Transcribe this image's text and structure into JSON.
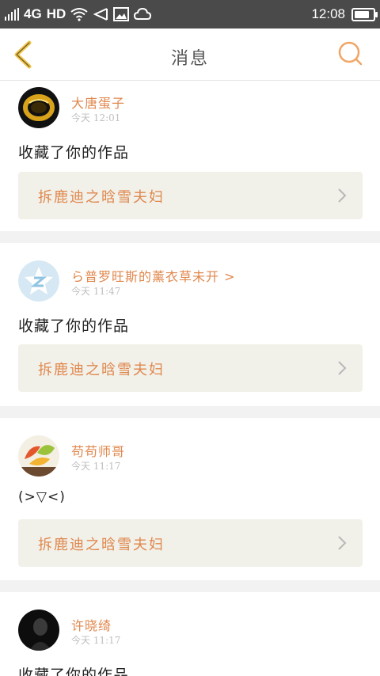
{
  "status_bar": {
    "network": "4G",
    "hd": "HD",
    "time": "12:08",
    "battery_level": 0.92
  },
  "header": {
    "title": "消息",
    "back_icon": "chevron-left-icon",
    "search_icon": "search-icon"
  },
  "colors": {
    "accent": "#e0874c",
    "back_accent": "#f0c54a",
    "card_bg": "#f1f1ea",
    "divider": "#f2f2f2"
  },
  "notifications": [
    {
      "name": "大唐蛋子",
      "time": "今天 12:01",
      "message": "收藏了你的作品",
      "work_title": "拆鹿迪之晗雪夫妇"
    },
    {
      "name": "ら普罗旺斯的薰衣草未开 >",
      "time": "今天 11:47",
      "message": "收藏了你的作品",
      "work_title": "拆鹿迪之晗雪夫妇"
    },
    {
      "name": "苟苟师哥",
      "time": "今天 11:17",
      "message": "(>▽<)",
      "work_title": "拆鹿迪之晗雪夫妇"
    },
    {
      "name": "许晓绮",
      "time": "今天 11:17",
      "message": "收藏了你的作品"
    }
  ]
}
